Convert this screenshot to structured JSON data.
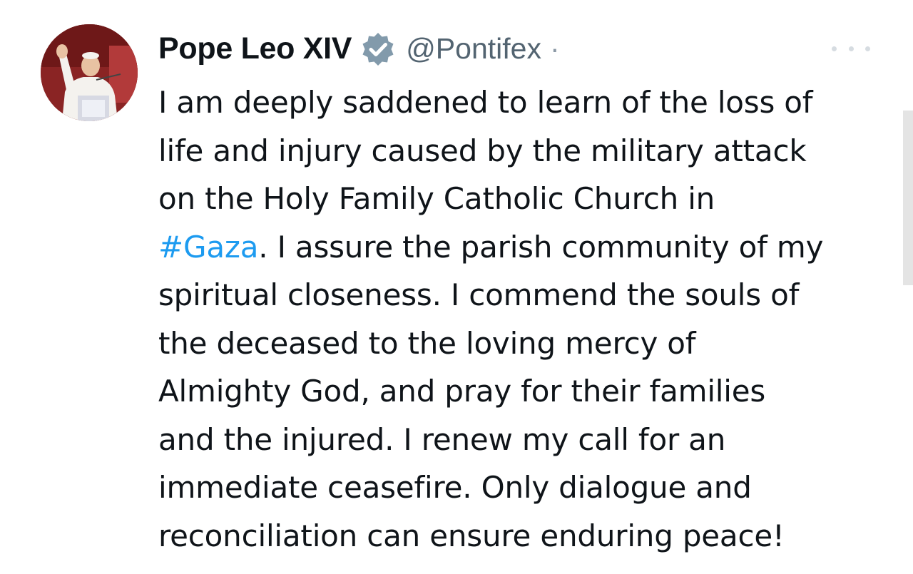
{
  "author": {
    "display_name": "Pope Leo XIV",
    "handle": "@Pontifex",
    "separator": "·",
    "verified_icon": "verified-badge-icon",
    "avatar_icon": "profile-photo"
  },
  "colors": {
    "text": "#0f1419",
    "muted": "#536471",
    "link": "#1d9bf0",
    "verified_badge": "#829aab"
  },
  "tweet": {
    "lines": {
      "l1": "I am deeply saddened to learn of the loss of",
      "l2": "life and injury caused by the military attack",
      "l3": "on the Holy Family Catholic Church in",
      "l4_hashtag": "#Gaza",
      "l4_rest": ". I assure the parish community of my",
      "l5": "spiritual closeness. I commend the souls of",
      "l6": "the deceased to the loving mercy of",
      "l7": "Almighty God, and pray for their families",
      "l8": "and the injured. I renew my call for an",
      "l9": "immediate ceasefire. Only dialogue and",
      "l10": "reconciliation can ensure enduring peace!"
    }
  },
  "actions": {
    "more_icon": "more-horizontal-icon"
  }
}
